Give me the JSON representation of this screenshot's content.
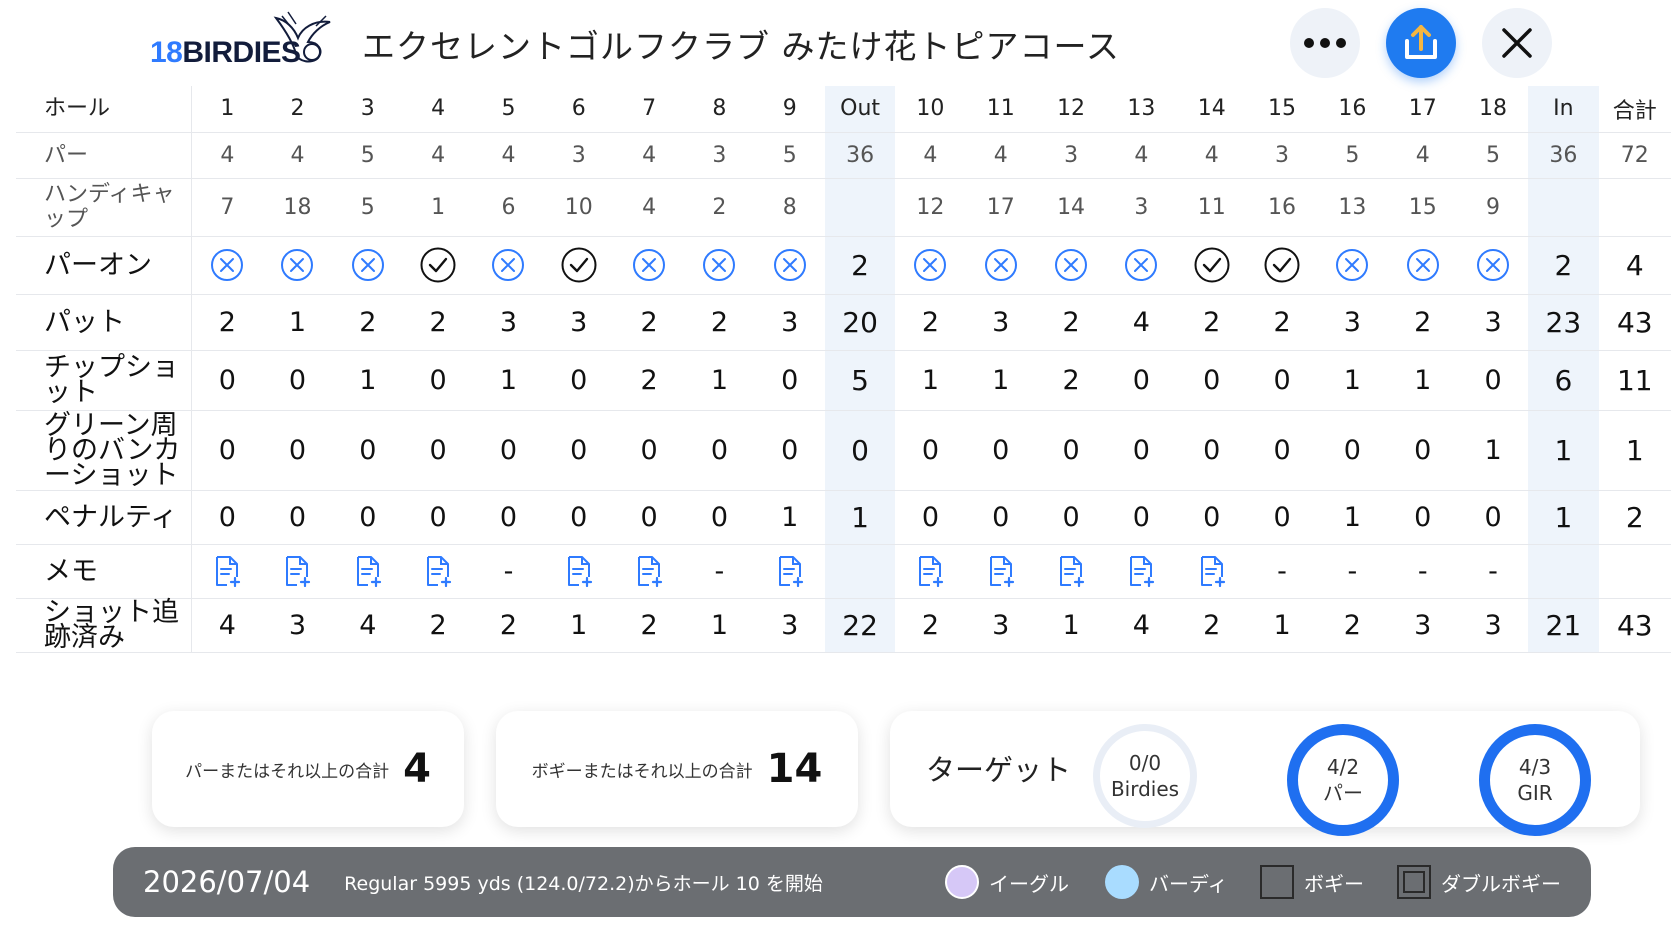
{
  "header": {
    "logo_number": "18",
    "logo_word": "BIRDIES",
    "course_name": "エクセレントゴルフクラブ みたけ花トピアコース",
    "more_icon": "more-horizontal-icon",
    "share_icon": "share-upload-icon",
    "close_icon": "close-icon"
  },
  "table": {
    "row_labels": {
      "hole": "ホール",
      "par": "パー",
      "handicap": "ハンディキャップ",
      "par_on": "パーオン",
      "putts": "パット",
      "chip": "チップショット",
      "bunker": "グリーン周りのバンカーショット",
      "penalty": "ペナルティ",
      "memo": "メモ",
      "tracked": "ショット追跡済み"
    },
    "holes": [
      "1",
      "2",
      "3",
      "4",
      "5",
      "6",
      "7",
      "8",
      "9",
      "Out",
      "10",
      "11",
      "12",
      "13",
      "14",
      "15",
      "16",
      "17",
      "18",
      "In",
      "合計"
    ],
    "par": [
      "4",
      "4",
      "5",
      "4",
      "4",
      "3",
      "4",
      "3",
      "5",
      "36",
      "4",
      "4",
      "3",
      "4",
      "4",
      "3",
      "5",
      "4",
      "5",
      "36",
      "72"
    ],
    "handicap": [
      "7",
      "18",
      "5",
      "1",
      "6",
      "10",
      "4",
      "2",
      "8",
      "",
      "12",
      "17",
      "14",
      "3",
      "11",
      "16",
      "13",
      "15",
      "9",
      "",
      ""
    ],
    "par_on": [
      "x",
      "x",
      "x",
      "check",
      "x",
      "check",
      "x",
      "x",
      "x",
      "2",
      "x",
      "x",
      "x",
      "x",
      "check",
      "check",
      "x",
      "x",
      "x",
      "2",
      "4"
    ],
    "putts": [
      "2",
      "1",
      "2",
      "2",
      "3",
      "3",
      "2",
      "2",
      "3",
      "20",
      "2",
      "3",
      "2",
      "4",
      "2",
      "2",
      "3",
      "2",
      "3",
      "23",
      "43"
    ],
    "chip": [
      "0",
      "0",
      "1",
      "0",
      "1",
      "0",
      "2",
      "1",
      "0",
      "5",
      "1",
      "1",
      "2",
      "0",
      "0",
      "0",
      "1",
      "1",
      "0",
      "6",
      "11"
    ],
    "bunker": [
      "0",
      "0",
      "0",
      "0",
      "0",
      "0",
      "0",
      "0",
      "0",
      "0",
      "0",
      "0",
      "0",
      "0",
      "0",
      "0",
      "0",
      "0",
      "1",
      "1",
      "1"
    ],
    "penalty": [
      "0",
      "0",
      "0",
      "0",
      "0",
      "0",
      "0",
      "0",
      "1",
      "1",
      "0",
      "0",
      "0",
      "0",
      "0",
      "0",
      "1",
      "0",
      "0",
      "1",
      "2"
    ],
    "memo": [
      "note",
      "note",
      "note",
      "note",
      "-",
      "note",
      "note",
      "-",
      "note",
      "",
      "note",
      "note",
      "note",
      "note",
      "note",
      "-",
      "-",
      "-",
      "-",
      "",
      ""
    ],
    "tracked": [
      "4",
      "3",
      "4",
      "2",
      "2",
      "1",
      "2",
      "1",
      "3",
      "22",
      "2",
      "3",
      "1",
      "4",
      "2",
      "1",
      "2",
      "3",
      "3",
      "21",
      "43"
    ]
  },
  "summary": {
    "par_or_better_label": "パーまたはそれ以上の合計",
    "par_or_better_value": "4",
    "bogey_or_better_label": "ボギーまたはそれ以上の合計",
    "bogey_or_better_value": "14",
    "target_label": "ターゲット",
    "targets": [
      {
        "top": "0/0",
        "bottom": "Birdies",
        "color": "#e9eef6",
        "filled": false
      },
      {
        "top": "4/2",
        "bottom": "パー",
        "color": "#1f6ff0",
        "filled": true
      },
      {
        "top": "4/3",
        "bottom": "GIR",
        "color": "#1f6ff0",
        "filled": true
      }
    ]
  },
  "footer": {
    "date": "2026/07/04",
    "tee_info": "Regular 5995 yds (124.0/72.2)からホール 10 を開始",
    "legend": [
      {
        "label": "イーグル",
        "shape": "circle",
        "color": "#d6c8f7"
      },
      {
        "label": "バーディ",
        "shape": "circle",
        "color": "#a9dcff"
      },
      {
        "label": "ボギー",
        "shape": "square",
        "color": "#6b6e72"
      },
      {
        "label": "ダブルボギー",
        "shape": "double-square",
        "color": "#6b6e72"
      }
    ]
  },
  "colors": {
    "accent": "#1f7bf0",
    "miss_icon": "#2f7bff",
    "hit_icon": "#111111",
    "total_column_bg": "#eef4fb",
    "footer_bg": "#6b6e72"
  }
}
